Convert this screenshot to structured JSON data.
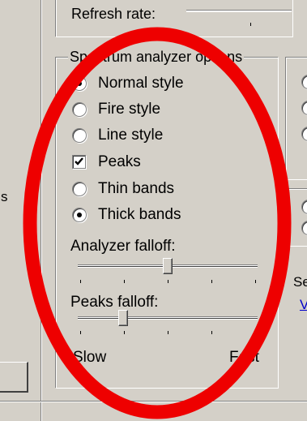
{
  "top": {
    "refresh_label": "Refresh rate:"
  },
  "spectrum": {
    "group_label": "Spectrum analyzer options",
    "radios": [
      {
        "label": "Normal style",
        "checked": true
      },
      {
        "label": "Fire style",
        "checked": false
      },
      {
        "label": "Line style",
        "checked": false
      }
    ],
    "peaks": {
      "label": "Peaks",
      "checked": true
    },
    "band_radios": [
      {
        "label": "Thin bands",
        "checked": false
      },
      {
        "label": "Thick bands",
        "checked": true
      }
    ],
    "analyzer_falloff": {
      "label": "Analyzer falloff:",
      "value": 0.5
    },
    "peaks_falloff": {
      "label": "Peaks falloff:",
      "value": 0.25
    },
    "slow_label": "Slow",
    "fast_label": "Fast"
  },
  "right": {
    "partial_label": "Se",
    "partial_link": "V"
  },
  "left": {
    "partial_label": "s"
  },
  "annotation": {
    "ellipse_color": "#ee0000"
  }
}
